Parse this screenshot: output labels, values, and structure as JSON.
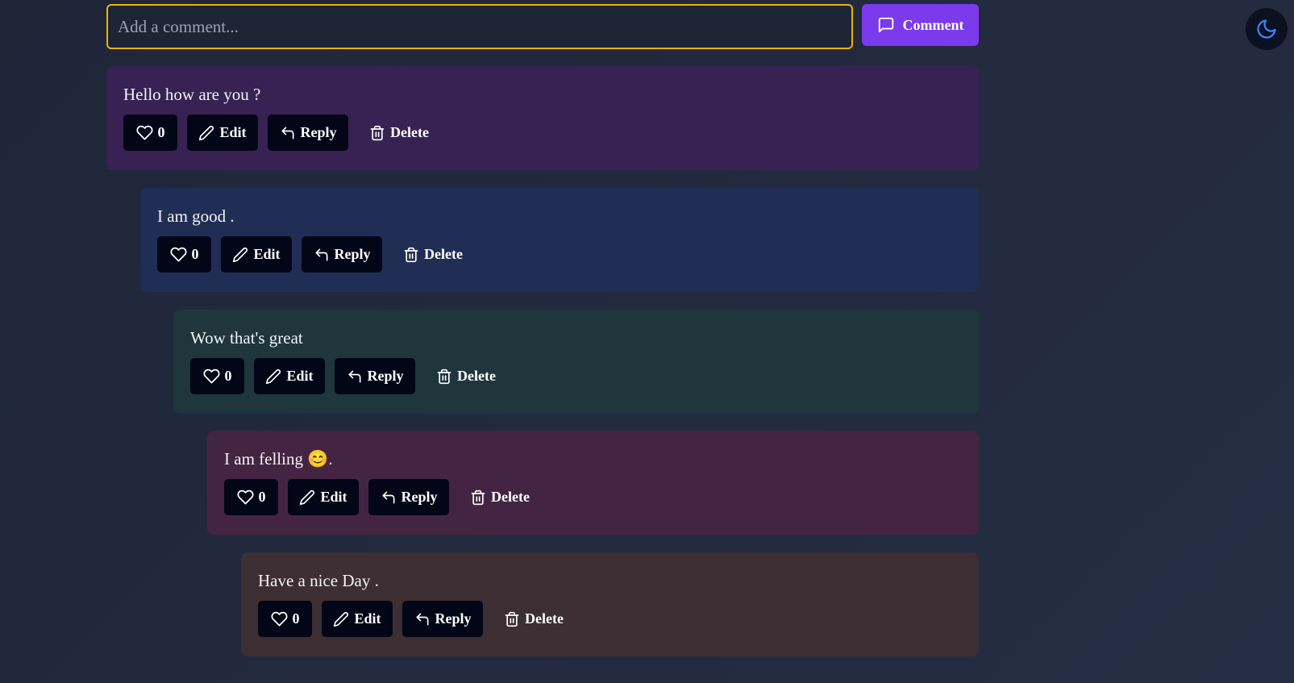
{
  "composer": {
    "placeholder": "Add a comment...",
    "value": "",
    "button_label": "Comment"
  },
  "theme_toggle": {
    "icon": "moon-icon"
  },
  "actions": {
    "edit_label": "Edit",
    "reply_label": "Reply",
    "delete_label": "Delete"
  },
  "comments": [
    {
      "text": "Hello how are you ?",
      "likes": "0",
      "color": "#372253"
    },
    {
      "text": "I am good .",
      "likes": "0",
      "color": "#202e56"
    },
    {
      "text": "Wow that's great",
      "likes": "0",
      "color": "#1e363c"
    },
    {
      "text": "I am felling 😊.",
      "likes": "0",
      "color": "#442443"
    },
    {
      "text": "Have a nice Day .",
      "likes": "0",
      "color": "#3c2e33"
    }
  ],
  "colors": {
    "accent": "#7c3aed",
    "input_border": "#eab308",
    "button_bg": "#020617"
  }
}
